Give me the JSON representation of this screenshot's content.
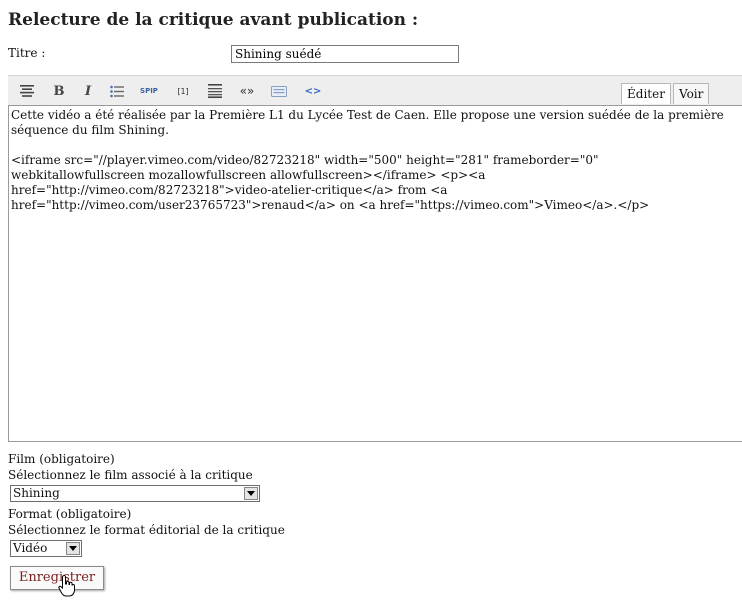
{
  "page_title": "Relecture de la critique avant publication :",
  "titre": {
    "label": "Titre :",
    "value": "Shining suédé"
  },
  "toolbar": {
    "icons": [
      "align-icon",
      "bold-icon",
      "italic-icon",
      "list-icon",
      "spip-icon",
      "footnote-icon",
      "paragraph-icon",
      "quote-icon",
      "keyboard-icon",
      "code-icon"
    ],
    "bold_glyph": "B",
    "italic_glyph": "I",
    "spip_glyph": "SPIP",
    "footnote_glyph": "[1]",
    "quote_glyph": "«»",
    "code_glyph": "<>",
    "tab_edit": "Éditer",
    "tab_view": "Voir"
  },
  "editor": {
    "content": "Cette vidéo a été réalisée par la Première L1 du Lycée Test de Caen. Elle propose une version suédée de la première\nséquence du film Shining.\n\n<iframe src=\"//player.vimeo.com/video/82723218\" width=\"500\" height=\"281\" frameborder=\"0\"\nwebkitallowfullscreen mozallowfullscreen allowfullscreen></iframe> <p><a\nhref=\"http://vimeo.com/82723218\">video-atelier-critique</a> from <a\nhref=\"http://vimeo.com/user23765723\">renaud</a> on <a href=\"https://vimeo.com\">Vimeo</a>.</p>"
  },
  "film": {
    "label": "Film (obligatoire)",
    "help": "Sélectionnez le film associé à la critique",
    "selected": "Shining"
  },
  "format": {
    "label": "Format (obligatoire)",
    "help": "Sélectionnez le format éditorial de la critique",
    "selected": "Vidéo"
  },
  "save_button": "Enregistrer"
}
